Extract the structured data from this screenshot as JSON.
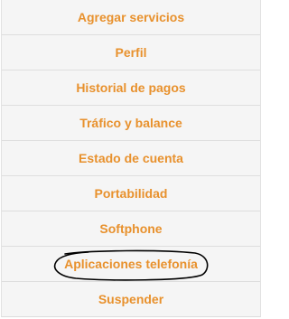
{
  "colors": {
    "link": "#e8912d",
    "background": "#f5f5f5",
    "divider": "#dedede",
    "annotation_ink": "#000000"
  },
  "menu": {
    "items": [
      {
        "label": "Agregar servicios"
      },
      {
        "label": "Perfil"
      },
      {
        "label": "Historial de pagos"
      },
      {
        "label": "Tráfico y balance"
      },
      {
        "label": "Estado de cuenta"
      },
      {
        "label": "Portabilidad"
      },
      {
        "label": "Softphone"
      },
      {
        "label": "Aplicaciones telefonía",
        "annotated": true
      },
      {
        "label": "Suspender"
      }
    ]
  }
}
